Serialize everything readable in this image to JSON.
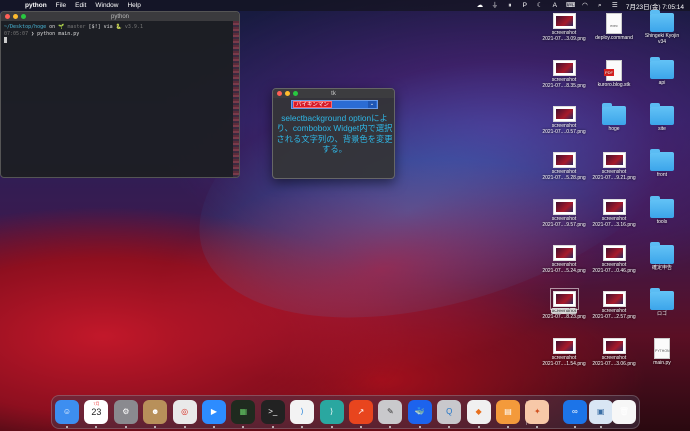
{
  "menubar": {
    "apple": "",
    "items": [
      "python",
      "File",
      "Edit",
      "Window",
      "Help"
    ],
    "clock": "7月23日(金)  7:05:14",
    "status_icons": [
      "dropbox-icon",
      "clipboard-icon",
      "parallel-icon",
      "p-icon",
      "moon-icon",
      "a-icon",
      "keyboard-icon",
      "wifi-icon",
      "search-icon",
      "control-center-icon"
    ],
    "status_glyphs": [
      "☁",
      "⏚",
      "⏸",
      "P",
      "☾",
      "A",
      "⌨",
      "◠",
      "⌕",
      "☰"
    ]
  },
  "terminal": {
    "title": "python",
    "line1_path": "~/Desktop/hoge",
    "line1_on": "on",
    "line1_branch": "🌱 master",
    "line1_status": "[$!]",
    "line1_via": "via",
    "line1_python": "🐍 v3.9.1",
    "line2_time": "07:05:07",
    "line2_cmd": "❯ python main.py"
  },
  "tk": {
    "title": "tk",
    "combo_value": "バイキンマン",
    "combo_arrow": "⌄",
    "description": "selectbackground optionにより、combobox Widget内で選択される文字列の、背景色を変更する。"
  },
  "desktop": {
    "icons": [
      {
        "label1": "screenshot",
        "label2": "2021-07....3.09.png",
        "type": "shot"
      },
      {
        "label1": "deploy.command",
        "label2": "",
        "type": "doc",
        "doc_text": "exec"
      },
      {
        "label1": "Shingeki Kyojin",
        "label2": "v34",
        "type": "folder"
      },
      {
        "label1": "screenshot",
        "label2": "2021-07....8.35.png",
        "type": "shot"
      },
      {
        "label1": "kuroro.blog.stk",
        "label2": "",
        "type": "docred",
        "tag": "PDF"
      },
      {
        "label1": "api",
        "label2": "",
        "type": "folder"
      },
      {
        "label1": "screenshot",
        "label2": "2021-07....0.57.png",
        "type": "shot"
      },
      {
        "label1": "hoge",
        "label2": "",
        "type": "folder"
      },
      {
        "label1": "site",
        "label2": "",
        "type": "folder"
      },
      {
        "label1": "screenshot",
        "label2": "2021-07....5.28.png",
        "type": "shot"
      },
      {
        "label1": "screenshot",
        "label2": "2021-07....9.21.png",
        "type": "shot"
      },
      {
        "label1": "front",
        "label2": "",
        "type": "folder"
      },
      {
        "label1": "screenshot",
        "label2": "2021-07....9.57.png",
        "type": "shot"
      },
      {
        "label1": "screenshot",
        "label2": "2021-07....3.16.png",
        "type": "shot"
      },
      {
        "label1": "tools",
        "label2": "",
        "type": "folder"
      },
      {
        "label1": "screenshot",
        "label2": "2021-07....5.24.png",
        "type": "shot"
      },
      {
        "label1": "screenshot",
        "label2": "2021-07....0.46.png",
        "type": "shot"
      },
      {
        "label1": "確定申告",
        "label2": "",
        "type": "folder"
      },
      {
        "label1": "screenshot",
        "label2": "2021-07....8.23.png",
        "type": "shot",
        "selected": true
      },
      {
        "label1": "screenshot",
        "label2": "2021-07....2.57.png",
        "type": "shot"
      },
      {
        "label1": "ロゴ",
        "label2": "",
        "type": "folder"
      },
      {
        "label1": "screenshot",
        "label2": "2021-07....1.54.png",
        "type": "shot"
      },
      {
        "label1": "screenshot",
        "label2": "2021-07....3.06.png",
        "type": "shot"
      },
      {
        "label1": "main.py",
        "label2": "",
        "type": "doc",
        "doc_text": "PYTHON"
      }
    ]
  },
  "dock": {
    "apps": [
      {
        "name": "finder-icon",
        "glyph": "☺",
        "bg": "#3d8ef0"
      },
      {
        "name": "calendar-icon",
        "glyph": "23",
        "bg": "#ffffff",
        "fg": "#222",
        "sub": "7月"
      },
      {
        "name": "system-preferences-icon",
        "glyph": "⚙",
        "bg": "#8a8a8f"
      },
      {
        "name": "contacts-icon",
        "glyph": "☻",
        "bg": "#b8905a"
      },
      {
        "name": "chrome-icon",
        "glyph": "◎",
        "bg": "#e9e9e9",
        "fg": "#d93025"
      },
      {
        "name": "zoom-icon",
        "glyph": "▶",
        "bg": "#2d8cff"
      },
      {
        "name": "activity-monitor-icon",
        "glyph": "▦",
        "bg": "#1f2a1f",
        "fg": "#6c6"
      },
      {
        "name": "terminal-icon",
        "glyph": ">_",
        "bg": "#222"
      },
      {
        "name": "vscode-icon",
        "glyph": "⟩",
        "bg": "#f3f3f3",
        "fg": "#1e7fd8"
      },
      {
        "name": "vscode-insiders-icon",
        "glyph": "⟩",
        "bg": "#2aa7a0"
      },
      {
        "name": "chart-app-icon",
        "glyph": "↗",
        "bg": "#e8451e"
      },
      {
        "name": "tool-app-icon",
        "glyph": "✎",
        "bg": "#c9c9cc",
        "fg": "#333"
      },
      {
        "name": "docker-icon",
        "glyph": "🐳",
        "bg": "#1d63ed"
      },
      {
        "name": "quicktime-icon",
        "glyph": "Q",
        "bg": "#c8c8cc",
        "fg": "#2276c9"
      },
      {
        "name": "sourcetree-icon",
        "glyph": "◆",
        "bg": "#f0f0f0",
        "fg": "#e8701e"
      },
      {
        "name": "books-icon",
        "glyph": "▤",
        "bg": "#f39a3b"
      },
      {
        "name": "draw-app-icon",
        "glyph": "✦",
        "bg": "#f7c8a8",
        "fg": "#d05020"
      },
      {
        "name": "infinity-app-icon",
        "glyph": "∞",
        "bg": "#1c74e8"
      },
      {
        "name": "preview-icon",
        "glyph": "▣",
        "bg": "#d9e6f4",
        "fg": "#3a6ea5"
      },
      {
        "name": "document-icon",
        "glyph": "",
        "bg": "#f7f7f7"
      },
      {
        "name": "trash-icon",
        "glyph": "🗑",
        "bg": "transparent"
      }
    ]
  }
}
